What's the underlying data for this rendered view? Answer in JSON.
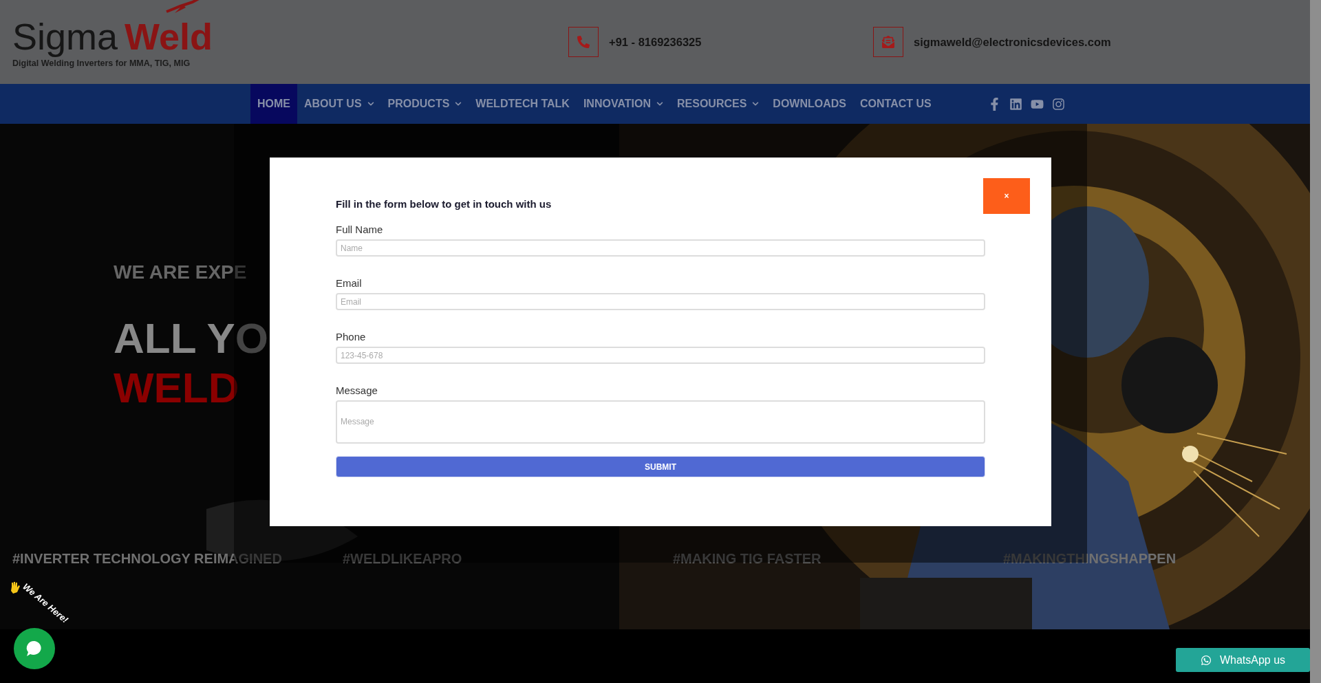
{
  "header": {
    "logo": {
      "word_1": "Sigma",
      "word_2": "Weld",
      "tagline": "Digital Welding Inverters for MMA, TIG, MIG"
    },
    "phone": "+91 - 8169236325",
    "email": "sigmaweld@electronicsdevices.com"
  },
  "nav": {
    "items": [
      {
        "label": "HOME",
        "selected": true,
        "dropdown": false
      },
      {
        "label": "ABOUT US",
        "selected": false,
        "dropdown": true
      },
      {
        "label": "PRODUCTS",
        "selected": false,
        "dropdown": true
      },
      {
        "label": "WELDTECH TALK",
        "selected": false,
        "dropdown": false
      },
      {
        "label": "INNOVATION",
        "selected": false,
        "dropdown": true
      },
      {
        "label": "RESOURCES",
        "selected": false,
        "dropdown": true
      },
      {
        "label": "DOWNLOADS",
        "selected": false,
        "dropdown": false
      },
      {
        "label": "CONTACT US",
        "selected": false,
        "dropdown": false
      }
    ]
  },
  "hero": {
    "tagline": "WE ARE EXPE",
    "headline_1": "ALL YO",
    "headline_2": "WELD",
    "hashtags": [
      "#INVERTER TECHNOLOGY REIMAGINED",
      "#WELDLIKEAPRO",
      "#MAKING TIG FASTER",
      "#MAKINGTHINGSHAPPEN"
    ]
  },
  "modal": {
    "heading": "Fill in the form below to get in touch with us",
    "close": "×",
    "fields": [
      {
        "kind": "input",
        "label": "Full Name",
        "placeholder": "Name"
      },
      {
        "kind": "input",
        "label": "Email",
        "placeholder": "Email"
      },
      {
        "kind": "input",
        "label": "Phone",
        "placeholder": "123-45-678"
      },
      {
        "kind": "textarea",
        "label": "Message",
        "placeholder": "Message"
      }
    ],
    "submit": "SUBMIT"
  },
  "chat_widget": {
    "caption": "We Are Here!"
  },
  "whatsapp": {
    "label": "WhatsApp us"
  }
}
